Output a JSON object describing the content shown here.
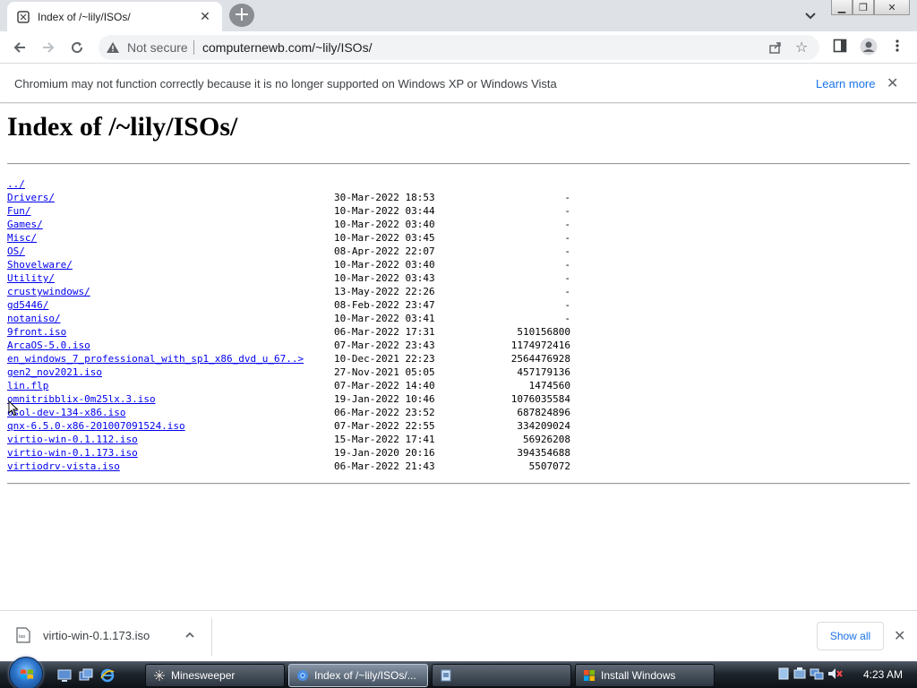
{
  "browser": {
    "tab_title": "Index of /~lily/ISOs/",
    "not_secure": "Not secure",
    "url": "computernewb.com/~lily/ISOs/"
  },
  "infobar": {
    "message": "Chromium may not function correctly because it is no longer supported on Windows XP or Windows Vista",
    "learn_more": "Learn more"
  },
  "page": {
    "heading": "Index of /~lily/ISOs/",
    "parent_link": "../",
    "entries": [
      {
        "name": "Drivers/",
        "date": "30-Mar-2022 18:53",
        "size": "-"
      },
      {
        "name": "Fun/",
        "date": "10-Mar-2022 03:44",
        "size": "-"
      },
      {
        "name": "Games/",
        "date": "10-Mar-2022 03:40",
        "size": "-"
      },
      {
        "name": "Misc/",
        "date": "10-Mar-2022 03:45",
        "size": "-"
      },
      {
        "name": "OS/",
        "date": "08-Apr-2022 22:07",
        "size": "-"
      },
      {
        "name": "Shovelware/",
        "date": "10-Mar-2022 03:40",
        "size": "-"
      },
      {
        "name": "Utility/",
        "date": "10-Mar-2022 03:43",
        "size": "-"
      },
      {
        "name": "crustywindows/",
        "date": "13-May-2022 22:26",
        "size": "-"
      },
      {
        "name": "gd5446/",
        "date": "08-Feb-2022 23:47",
        "size": "-"
      },
      {
        "name": "notaniso/",
        "date": "10-Mar-2022 03:41",
        "size": "-"
      },
      {
        "name": "9front.iso",
        "date": "06-Mar-2022 17:31",
        "size": "510156800"
      },
      {
        "name": "ArcaOS-5.0.iso",
        "date": "07-Mar-2022 23:43",
        "size": "1174972416"
      },
      {
        "name": "en_windows_7_professional_with_sp1_x86_dvd_u_67..>",
        "date": "10-Dec-2021 22:23",
        "size": "2564476928"
      },
      {
        "name": "gen2_nov2021.iso",
        "date": "27-Nov-2021 05:05",
        "size": "457179136"
      },
      {
        "name": "lin.flp",
        "date": "07-Mar-2022 14:40",
        "size": "1474560"
      },
      {
        "name": "omnitribblix-0m25lx.3.iso",
        "date": "19-Jan-2022 10:46",
        "size": "1076035584"
      },
      {
        "name": "osol-dev-134-x86.iso",
        "date": "06-Mar-2022 23:52",
        "size": "687824896"
      },
      {
        "name": "qnx-6.5.0-x86-201007091524.iso",
        "date": "07-Mar-2022 22:55",
        "size": "334209024"
      },
      {
        "name": "virtio-win-0.1.112.iso",
        "date": "15-Mar-2022 17:41",
        "size": "56926208"
      },
      {
        "name": "virtio-win-0.1.173.iso",
        "date": "19-Jan-2020 20:16",
        "size": "394354688"
      },
      {
        "name": "virtiodrv-vista.iso",
        "date": "06-Mar-2022 21:43",
        "size": "5507072"
      }
    ]
  },
  "downloads": {
    "file_name": "virtio-win-0.1.173.iso",
    "show_all": "Show all"
  },
  "taskbar": {
    "buttons": [
      {
        "label": "Minesweeper",
        "icon": "minesweeper-icon"
      },
      {
        "label": "Index of /~lily/ISOs/...",
        "icon": "chromium-icon"
      },
      {
        "label": "",
        "icon": "setup-icon"
      },
      {
        "label": "Install Windows",
        "icon": "install-windows-icon"
      }
    ],
    "clock": "4:23 AM"
  },
  "colors": {
    "link": "#0000ee",
    "accent_blue": "#1a73e8",
    "tab_strip": "#dee1e6"
  }
}
